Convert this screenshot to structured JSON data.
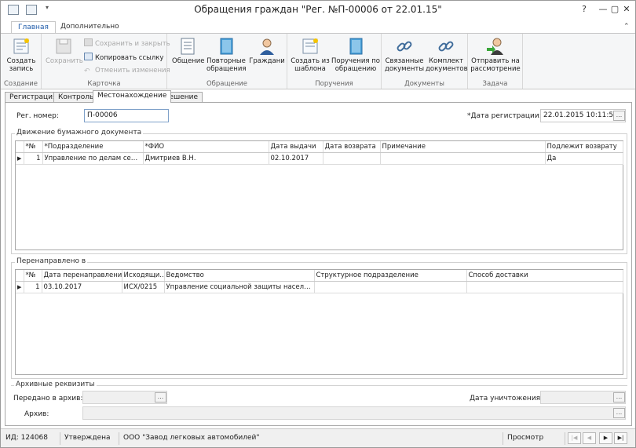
{
  "window": {
    "title": "Обращения граждан \"Рег. №П-00006 от 22.01.15\"",
    "help": "?",
    "minimize": "—",
    "maximize": "▢",
    "close": "✕"
  },
  "ribbon_tabs": [
    "Главная",
    "Дополнительно"
  ],
  "ribbon": {
    "create": {
      "label1": "Создать",
      "label2": "запись",
      "group": "Создание"
    },
    "save": {
      "label": "Сохранить"
    },
    "card": {
      "save_close": "Сохранить и закрыть",
      "copy_link": "Копировать ссылку",
      "cancel_changes": "Отменить изменения",
      "group": "Карточка"
    },
    "appeal": {
      "general": "Общение",
      "repeat1": "Повторные",
      "repeat2": "обращения",
      "citizen": "Граждани",
      "group": "Обращение"
    },
    "orders": {
      "from_tpl1": "Создать из",
      "from_tpl2": "шаблона",
      "orders1": "Поручения по",
      "orders2": "обращению",
      "group": "Поручения"
    },
    "documents": {
      "linked1": "Связанные",
      "linked2": "документы",
      "set1": "Комплект",
      "set2": "документов",
      "group": "Документы"
    },
    "task": {
      "send1": "Отправить на",
      "send2": "рассмотрение",
      "group": "Задача"
    }
  },
  "page_tabs": [
    "Регистрация",
    "Контроль",
    "Местонахождение",
    "Решение"
  ],
  "reg": {
    "number_label": "Рег. номер:",
    "number_value": "П-00006",
    "date_label": "*Дата регистрации:",
    "date_value": "22.01.2015 10:11:50",
    "ellipsis": "..."
  },
  "movement": {
    "title": "Движение бумажного документа",
    "columns": [
      "*№",
      "*Подразделение",
      "*ФИО",
      "Дата выдачи",
      "Дата возврата",
      "Примечание",
      "Подлежит возврату"
    ],
    "rows": [
      {
        "marker": "▶",
        "num": "1",
        "dept": "Управление по делам семьи...",
        "fio": "Дмитриев В.Н.",
        "issued": "02.10.2017",
        "returned": "",
        "note": "",
        "must_return": "Да"
      }
    ]
  },
  "redirected": {
    "title": "Перенаправлено в",
    "columns": [
      "*№",
      "Дата перенаправления",
      "Исходящи...",
      "Ведомство",
      "Структурное подразделение",
      "Способ доставки"
    ],
    "rows": [
      {
        "marker": "▶",
        "num": "1",
        "date": "03.10.2017",
        "outgoing": "ИСХ/0215",
        "agency": "Управление социальной защиты населени...",
        "unit": "",
        "delivery": ""
      }
    ]
  },
  "archive": {
    "title": "Архивные реквизиты",
    "transferred_label": "Передано в архив:",
    "destruction_label": "Дата уничтожения:",
    "archive_label": "Архив:",
    "ellipsis": "..."
  },
  "status": {
    "id": "ИД: 124068",
    "state": "Утверждена",
    "org": "ООО \"Завод легковых автомобилей\"",
    "mode": "Просмотр",
    "nav_first": "|◀",
    "nav_prev": "◀",
    "nav_next": "▶",
    "nav_last": "▶|"
  }
}
